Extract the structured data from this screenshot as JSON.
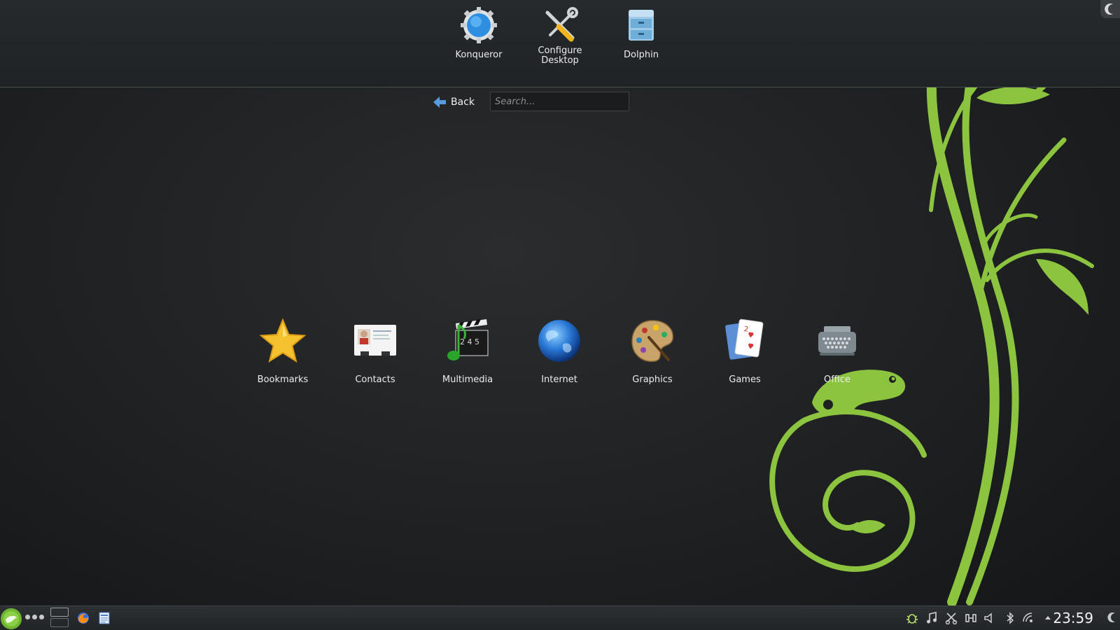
{
  "favorites": [
    {
      "label": "Konqueror",
      "icon": "konqueror-icon"
    },
    {
      "label": "Configure Desktop",
      "icon": "configure-desktop-icon"
    },
    {
      "label": "Dolphin",
      "icon": "dolphin-icon"
    }
  ],
  "navigation": {
    "back_label": "Back",
    "search_placeholder": "Search..."
  },
  "categories": [
    {
      "label": "Bookmarks",
      "icon": "star-icon"
    },
    {
      "label": "Contacts",
      "icon": "contacts-card-icon"
    },
    {
      "label": "Multimedia",
      "icon": "multimedia-clapper-icon"
    },
    {
      "label": "Internet",
      "icon": "globe-icon"
    },
    {
      "label": "Graphics",
      "icon": "paint-palette-icon"
    },
    {
      "label": "Games",
      "icon": "playing-cards-icon"
    },
    {
      "label": "Office",
      "icon": "typewriter-icon"
    }
  ],
  "panel": {
    "clock": "23:59",
    "tray_icons": [
      "bug-icon",
      "music-icon",
      "scissors-icon",
      "network-icon",
      "volume-icon",
      "bluetooth-icon",
      "wifi-icon",
      "expand-arrow-icon"
    ]
  },
  "colors": {
    "wallpaper_green": "#8bc34a",
    "background_dark": "#1e2022"
  }
}
